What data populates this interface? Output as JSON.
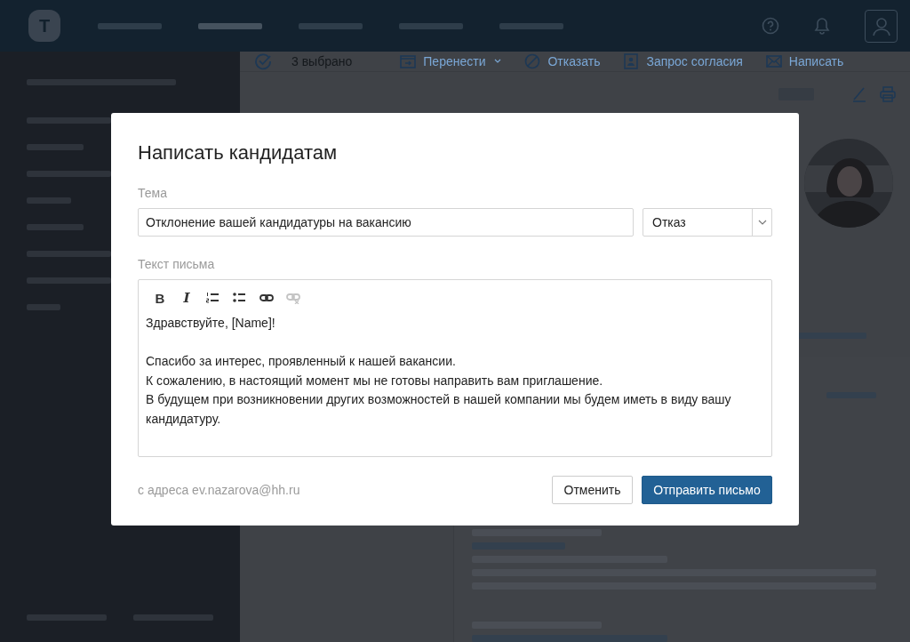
{
  "top_bar": {
    "logo": "T"
  },
  "action_bar": {
    "selected_count": "3 выбрано",
    "actions": [
      {
        "kind": "move",
        "label": "Перенести",
        "dropdown": true
      },
      {
        "kind": "reject",
        "label": "Отказать",
        "dropdown": false
      },
      {
        "kind": "consent",
        "label": "Запрос согласия",
        "dropdown": false
      },
      {
        "kind": "mail",
        "label": "Написать",
        "dropdown": false
      }
    ]
  },
  "modal": {
    "title": "Написать кандидатам",
    "subject": {
      "label": "Тема",
      "value": "Отклонение вашей кандидатуры на вакансию"
    },
    "template": {
      "value": "Отказ"
    },
    "body_label": "Текст письма",
    "toolbar": [
      {
        "kind": "bold",
        "label": "B",
        "disabled": false
      },
      {
        "kind": "italic",
        "label": "I",
        "disabled": false
      },
      {
        "kind": "ordered-list",
        "disabled": false
      },
      {
        "kind": "bullet-list",
        "disabled": false
      },
      {
        "kind": "link",
        "disabled": false
      },
      {
        "kind": "unlink",
        "disabled": true
      }
    ],
    "body": [
      "Здравствуйте, [Name]!",
      "Спасибо за интерес, проявленный к нашей вакансии.\nК сожалению, в настоящий момент мы не готовы направить вам приглашение.\nВ будущем при возникновении других возможностей в нашей компании мы будем иметь в виду вашу кандидатуру."
    ],
    "sender": "с адреса ev.nazarova@hh.ru",
    "buttons": [
      {
        "kind": "secondary",
        "label": "Отменить"
      },
      {
        "kind": "primary",
        "label": "Отправить письмо"
      }
    ]
  }
}
